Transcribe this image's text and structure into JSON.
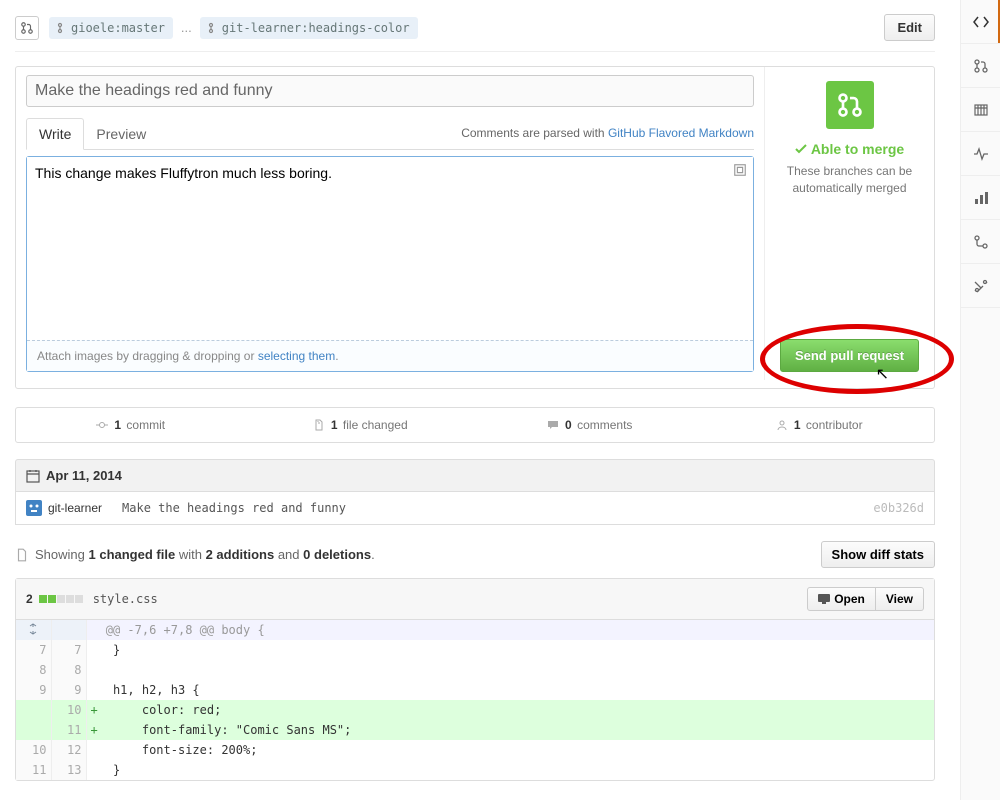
{
  "branches": {
    "base": "gioele:master",
    "head": "git-learner:headings-color"
  },
  "buttons": {
    "edit": "Edit",
    "send": "Send pull request",
    "diff_stats": "Show diff stats",
    "open": "Open",
    "view": "View"
  },
  "form": {
    "title": "Make the headings red and funny",
    "tabs": {
      "write": "Write",
      "preview": "Preview"
    },
    "markdown_note": {
      "prefix": "Comments are parsed with ",
      "link": "GitHub Flavored Markdown"
    },
    "body": "This change makes Fluffytron much less boring.",
    "dropzone": {
      "prefix": "Attach images by dragging & dropping or ",
      "link": "selecting them"
    }
  },
  "merge": {
    "title": "Able to merge",
    "desc": "These branches can be automatically merged"
  },
  "stats": {
    "commits": {
      "count": "1",
      "label": "commit"
    },
    "files": {
      "count": "1",
      "label": "file changed"
    },
    "comments": {
      "count": "0",
      "label": "comments"
    },
    "contributors": {
      "count": "1",
      "label": "contributor"
    }
  },
  "commits": {
    "date": "Apr 11, 2014",
    "items": [
      {
        "user": "git-learner",
        "message": "Make the headings red and funny",
        "sha": "e0b326d"
      }
    ]
  },
  "diff": {
    "summary": {
      "showing": "Showing",
      "files": "1 changed file",
      "with": "with",
      "additions": "2 additions",
      "and": "and",
      "deletions": "0 deletions"
    },
    "file": {
      "add_count": "2",
      "name": "style.css",
      "hunk": "@@ -7,6 +7,8 @@ body {",
      "lines": [
        {
          "old": "7",
          "new": "7",
          "code": " }"
        },
        {
          "old": "8",
          "new": "8",
          "code": ""
        },
        {
          "old": "9",
          "new": "9",
          "code": " h1, h2, h3 {"
        },
        {
          "old": "",
          "new": "10",
          "code": "     color: red;"
        },
        {
          "old": "",
          "new": "11",
          "code": "     font-family: \"Comic Sans MS\";"
        },
        {
          "old": "10",
          "new": "12",
          "code": "     font-size: 200%;"
        },
        {
          "old": "11",
          "new": "13",
          "code": " }"
        }
      ]
    }
  }
}
